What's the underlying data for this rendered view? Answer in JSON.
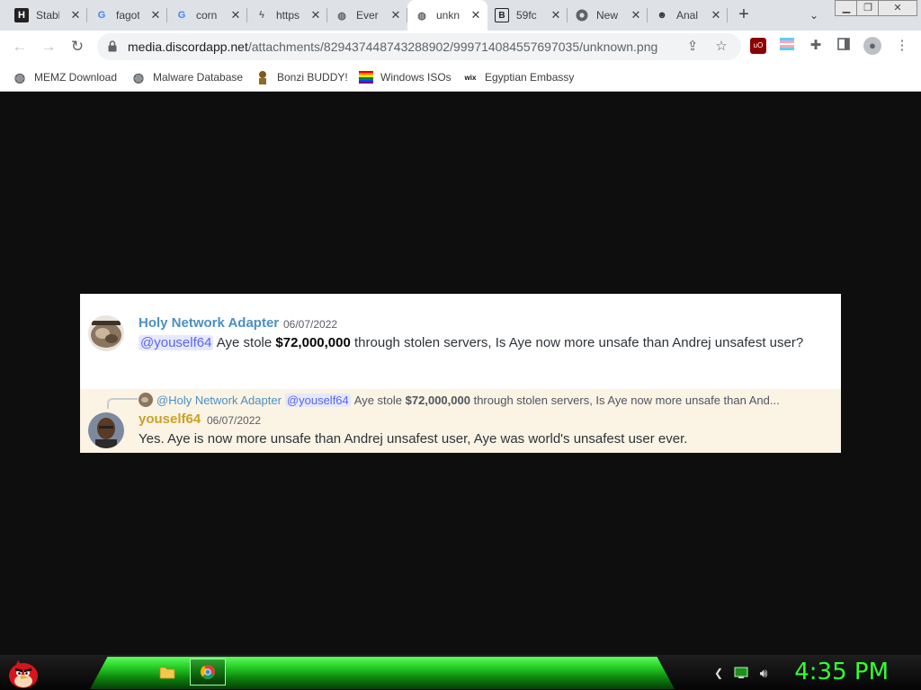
{
  "tabs": [
    {
      "title": "Stabl",
      "icon": "h-logo-icon",
      "active": false
    },
    {
      "title": "fagot",
      "icon": "google-icon",
      "active": false
    },
    {
      "title": "corn",
      "icon": "google-icon",
      "active": false
    },
    {
      "title": "https",
      "icon": "rss-icon",
      "active": false
    },
    {
      "title": "Ever",
      "icon": "globe-icon",
      "active": false
    },
    {
      "title": "unkn",
      "icon": "globe-icon",
      "active": true
    },
    {
      "title": "59fc",
      "icon": "b-logo-icon",
      "active": false
    },
    {
      "title": "New",
      "icon": "chrome-icon",
      "active": false
    },
    {
      "title": "Anal",
      "icon": "mask-icon",
      "active": false
    }
  ],
  "toolbar": {
    "url_host": "media.discordapp.net",
    "url_path": "/attachments/829437448743288902/999714084557697035/unknown.png"
  },
  "bookmarks": [
    {
      "label": "MEMZ Download",
      "icon": "globe-icon"
    },
    {
      "label": "Malware Database",
      "icon": "globe-icon"
    },
    {
      "label": "Bonzi BUDDY!",
      "icon": "bonzi-icon"
    },
    {
      "label": "Windows ISOs",
      "icon": "rainbow-flag-icon"
    },
    {
      "label": "Egyptian Embassy",
      "icon": "wix-icon"
    }
  ],
  "discord": {
    "message1": {
      "username": "Holy Network Adapter",
      "username_color": "#4a90c2",
      "timestamp": "06/07/2022",
      "mention": "@youself64",
      "text_before": "Aye stole",
      "bold": "$72,000,000",
      "text_after": "through stolen servers, Is Aye now more unsafe than Andrej unsafest user?"
    },
    "reply_preview": {
      "username": "@Holy Network Adapter",
      "mention": "@youself64",
      "text_before": "Aye stole",
      "bold": "$72,000,000",
      "text_after": "through stolen servers, Is Aye now more unsafe than And..."
    },
    "message2": {
      "username": "youself64",
      "username_color": "#c9a227",
      "timestamp": "06/07/2022",
      "text": "Yes. Aye is now more unsafe than Andrej unsafest user, Aye was world's unsafest user ever."
    }
  },
  "taskbar": {
    "clock": "4:35 PM",
    "clock_color": "#33ff33"
  }
}
